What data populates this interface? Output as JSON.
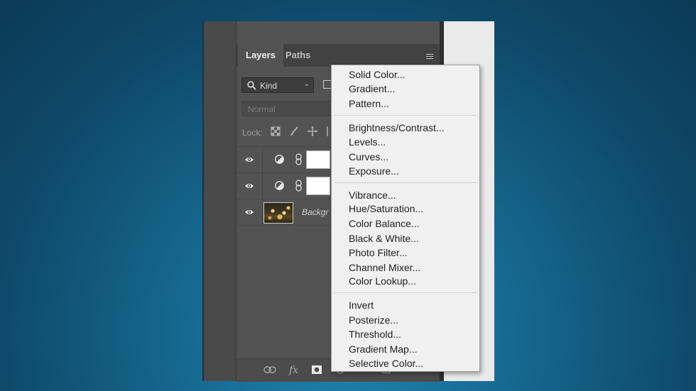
{
  "panel": {
    "tabs": [
      "Layers",
      "Paths"
    ],
    "kind_label": "Kind",
    "blend_mode": "Normal",
    "lock_label": "Lock:",
    "layers": [
      {
        "type": "adjustment"
      },
      {
        "type": "adjustment"
      },
      {
        "type": "image",
        "name": "Backgr"
      }
    ],
    "bottom_icons": [
      "link-icon",
      "fx-icon",
      "mask-icon",
      "adjustment-icon",
      "group-icon",
      "new-layer-icon"
    ],
    "fx_label": "fx"
  },
  "menu": {
    "groups": [
      [
        "Solid Color...",
        "Gradient...",
        "Pattern..."
      ],
      [
        "Brightness/Contrast...",
        "Levels...",
        "Curves...",
        "Exposure..."
      ],
      [
        "Vibrance...",
        "Hue/Saturation...",
        "Color Balance...",
        "Black & White...",
        "Photo Filter...",
        "Channel Mixer...",
        "Color Lookup..."
      ],
      [
        "Invert",
        "Posterize...",
        "Threshold...",
        "Gradient Map...",
        "Selective Color..."
      ]
    ]
  },
  "colors": {
    "background": "#0f4a6b",
    "panel": "#535353",
    "menu": "#f0f0f0"
  }
}
